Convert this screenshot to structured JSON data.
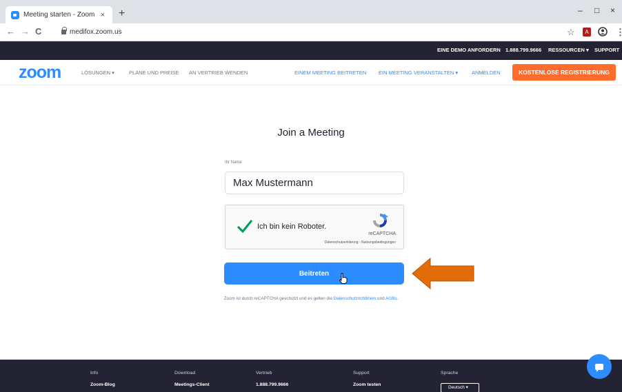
{
  "browser": {
    "tab_title": "Meeting starten - Zoom",
    "tab_close": "×",
    "new_tab": "+",
    "url": "medifox.zoom.us",
    "minimize": "–",
    "maximize": "□",
    "close": "×",
    "back": "←",
    "forward": "→",
    "reload": "C",
    "bookmark_star": "☆",
    "menu": "⋮"
  },
  "top_bar": {
    "demo": "EINE DEMO ANFORDERN",
    "phone": "1.888.799.9666",
    "resources": "RESSOURCEN ▾",
    "support": "SUPPORT"
  },
  "nav": {
    "logo": "zoom",
    "solutions": "LÖSUNGEN ▾",
    "plans": "PLÄNE UND PREISE",
    "sales": "AN VERTRIEB WENDEN",
    "join": "EINEM MEETING BEITRETEN",
    "host": "EIN MEETING VERANSTALTEN ▾",
    "signin": "ANMELDEN",
    "signup": "KOSTENLOSE REGISTRIERUNG"
  },
  "form": {
    "title": "Join a Meeting",
    "name_label": "Ihr Name",
    "name_value": "Max Mustermann",
    "captcha_label": "Ich bin kein Roboter.",
    "captcha_brand": "reCAPTCHA",
    "captcha_links": "Datenschutzerklärung - Nutzungsbedingungen",
    "join_button": "Beitreten",
    "legal_prefix": "Zoom ist durch reCAPTCHA geschützt und es gelten die ",
    "legal_privacy": "Datenschutzrichtlinien",
    "legal_and": " und ",
    "legal_terms": "AGBs",
    "legal_suffix": "."
  },
  "footer": {
    "info_head": "Info",
    "info_item": "Zoom-Blog",
    "download_head": "Download",
    "download_item": "Meetings-Client",
    "sales_head": "Vertrieb",
    "sales_item": "1.888.799.9666",
    "support_head": "Support",
    "support_item": "Zoom testen",
    "lang_head": "Sprache",
    "lang_value": "Deutsch ▾"
  },
  "colors": {
    "brand_blue": "#2d8cff",
    "signup_orange": "#ff6c2c",
    "dark_bg": "#232333",
    "annotation_arrow": "#e36c0a"
  }
}
